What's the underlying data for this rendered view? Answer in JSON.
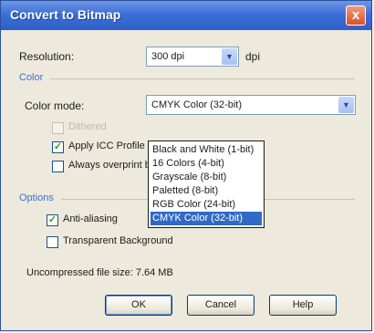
{
  "dialog": {
    "title": "Convert to Bitmap",
    "close_glyph": "x"
  },
  "resolution": {
    "label": "Resolution:",
    "value": "300 dpi",
    "unit": "dpi"
  },
  "color": {
    "section_label": "Color",
    "mode_label": "Color mode:",
    "mode_value": "CMYK Color (32-bit)",
    "options": [
      "Black and White (1-bit)",
      "16 Colors (4-bit)",
      "Grayscale (8-bit)",
      "Paletted (8-bit)",
      "RGB Color (24-bit)",
      "CMYK Color (32-bit)"
    ],
    "selected_index": 5,
    "dithered_label": "Dithered",
    "apply_icc_label": "Apply ICC Profile",
    "always_overprint_label": "Always overprint black"
  },
  "options": {
    "section_label": "Options",
    "anti_aliasing_label": "Anti-aliasing",
    "transparent_bg_label": "Transparent Background"
  },
  "file_size": {
    "text": "Uncompressed file size: 7.64 MB"
  },
  "buttons": {
    "ok": "OK",
    "cancel": "Cancel",
    "help": "Help"
  },
  "icons": {
    "check": "✓",
    "dropdown": "▼"
  }
}
